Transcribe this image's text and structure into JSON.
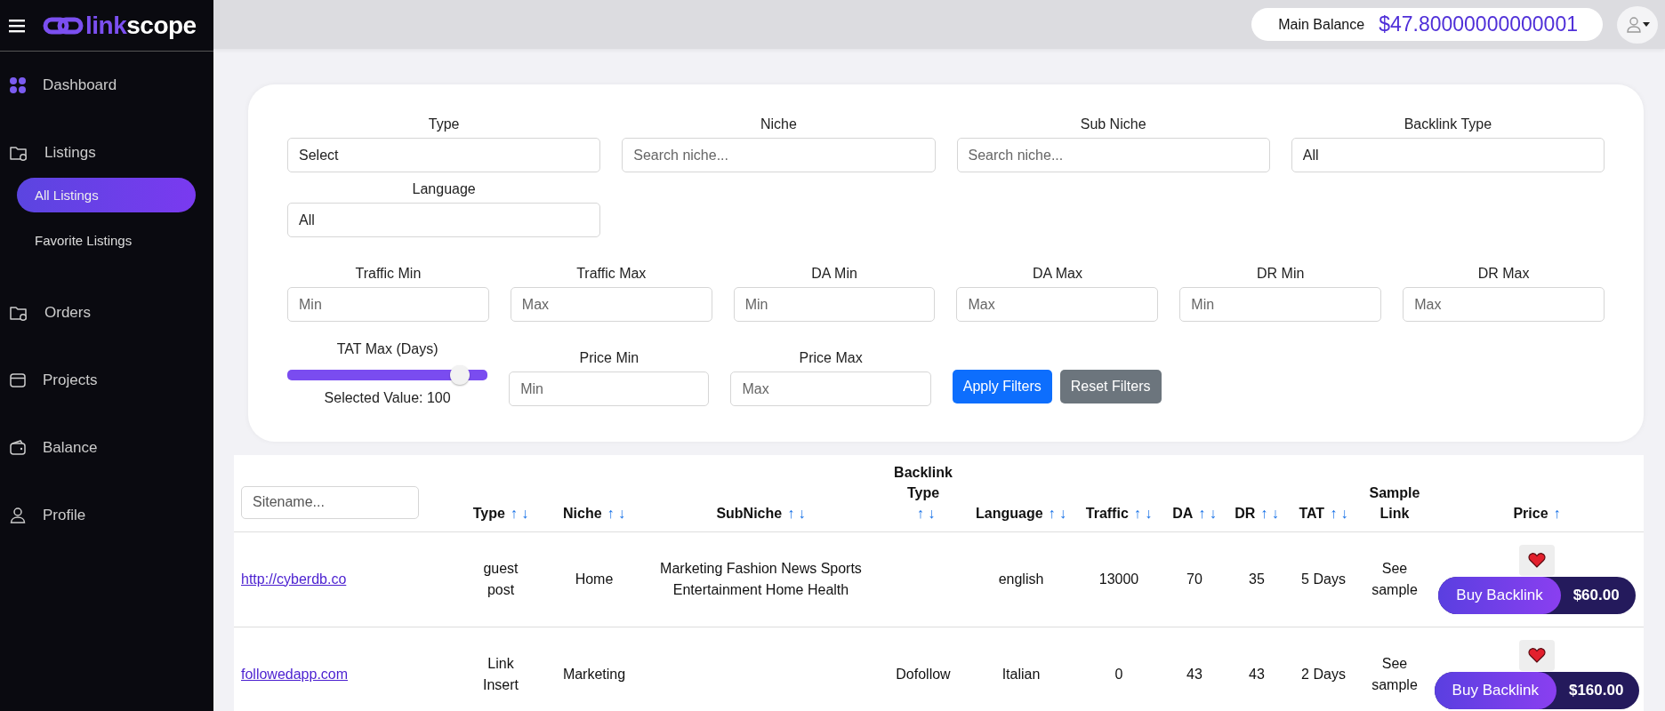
{
  "sidebar": {
    "logo": {
      "part_1": "link",
      "part_2": "scope"
    },
    "items": [
      {
        "label": "Dashboard",
        "kind": "dashboard",
        "selected": false
      },
      {
        "label": "Listings",
        "kind": "folder",
        "selected": false,
        "children": [
          {
            "label": "All Listings",
            "selected": true
          },
          {
            "label": "Favorite Listings",
            "selected": false
          }
        ]
      },
      {
        "label": "Orders",
        "kind": "folder",
        "selected": false
      },
      {
        "label": "Projects",
        "kind": "window",
        "selected": false
      },
      {
        "label": "Balance",
        "kind": "wallet",
        "selected": false
      },
      {
        "label": "Profile",
        "kind": "user",
        "selected": false
      }
    ]
  },
  "header": {
    "balance_label": "Main Balance",
    "balance_value": "$47.80000000000001"
  },
  "filters": {
    "sections": [
      {
        "fields": [
          {
            "kind": "select",
            "label": "Type",
            "value": "Select"
          },
          {
            "kind": "text",
            "label": "Niche",
            "placeholder": "Search niche..."
          },
          {
            "kind": "text",
            "label": "Sub Niche",
            "placeholder": "Search niche..."
          },
          {
            "kind": "select",
            "label": "Backlink Type",
            "value": "All"
          },
          {
            "kind": "select",
            "label": "Language",
            "value": "All"
          }
        ]
      },
      {
        "fields": [
          {
            "kind": "text",
            "label": "Traffic Min",
            "placeholder": "Min"
          },
          {
            "kind": "text",
            "label": "Traffic Max",
            "placeholder": "Max"
          },
          {
            "kind": "text",
            "label": "DA Min",
            "placeholder": "Min"
          },
          {
            "kind": "text",
            "label": "DA Max",
            "placeholder": "Max"
          },
          {
            "kind": "text",
            "label": "DR Min",
            "placeholder": "Min"
          },
          {
            "kind": "text",
            "label": "DR Max",
            "placeholder": "Max"
          }
        ]
      },
      {
        "fields": [
          {
            "kind": "slider",
            "label": "TAT Max (Days)",
            "level": 0.9,
            "reading": "Selected Value: 100"
          },
          {
            "kind": "text",
            "label": "Price Min",
            "placeholder": "Min"
          },
          {
            "kind": "text",
            "label": "Price Max",
            "placeholder": "Max"
          }
        ],
        "buttons": [
          {
            "label": "Apply Filters",
            "kind": "primary"
          },
          {
            "label": "Reset Filters",
            "kind": "secondary"
          }
        ]
      }
    ]
  },
  "table": {
    "search": {
      "placeholder": "Sitename..."
    },
    "columns": [
      {
        "label": "Type",
        "sort": "↑ ↓"
      },
      {
        "label": "Niche",
        "sort": "↑ ↓"
      },
      {
        "label": "SubNiche",
        "sort": "↑ ↓"
      },
      {
        "label": "Backlink Type",
        "sort": "↑ ↓"
      },
      {
        "label": "Language",
        "sort": "↑ ↓"
      },
      {
        "label": "Traffic",
        "sort": "↑ ↓"
      },
      {
        "label": "DA",
        "sort": "↑ ↓"
      },
      {
        "label": "DR",
        "sort": "↑ ↓"
      },
      {
        "label": "TAT",
        "sort": "↑ ↓"
      },
      {
        "label": "Sample Link"
      },
      {
        "label": "Price",
        "sort": "↑"
      }
    ],
    "rows": [
      {
        "site": "http://cyberdb.co",
        "type": "guest post",
        "niche": "Home",
        "subniche": "Marketing Fashion News Sports Entertainment Home Health",
        "language": "english",
        "traffic": "13000",
        "da": "70",
        "dr": "35",
        "tat": "5 Days",
        "sample": "See sample",
        "buy": "Buy Backlink",
        "price": "$60.00"
      },
      {
        "site": "followedapp.com",
        "type": "Link Insert",
        "niche": "Marketing",
        "backlink_type": "Dofollow",
        "language": "Italian",
        "traffic": "0",
        "da": "43",
        "dr": "43",
        "tat": "2 Days",
        "sample": "See sample",
        "buy": "Buy Backlink",
        "price": "$160.00"
      }
    ]
  }
}
